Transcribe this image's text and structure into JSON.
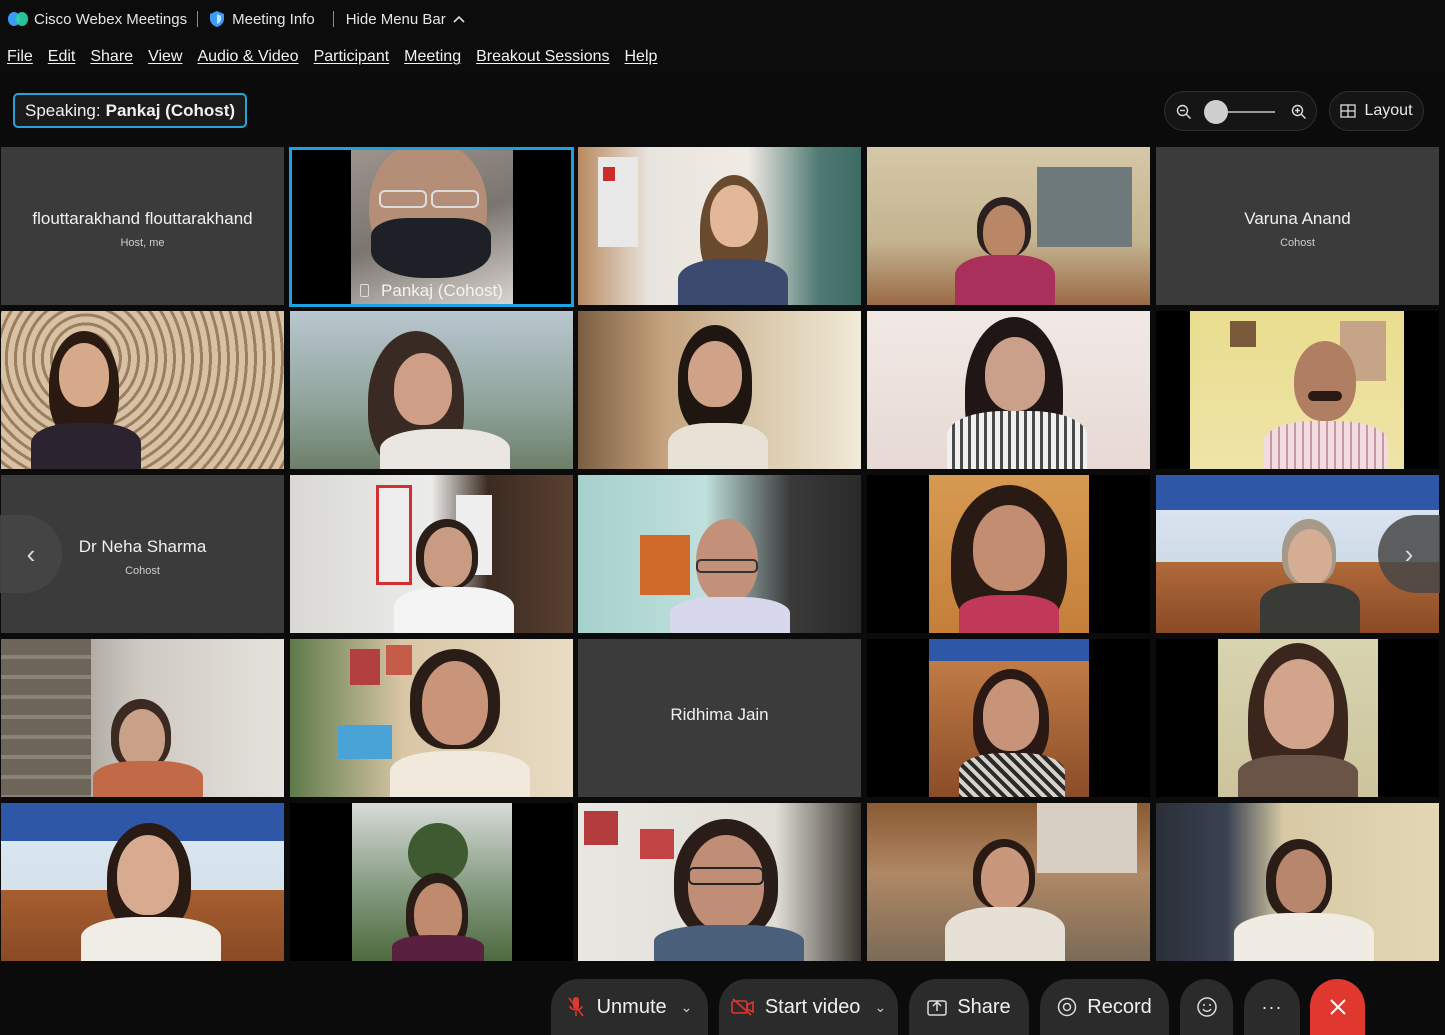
{
  "titlebar": {
    "app_name": "Cisco Webex Meetings",
    "meeting_info": "Meeting Info",
    "hide_menu": "Hide Menu Bar"
  },
  "menu": [
    "File",
    "Edit",
    "Share",
    "View",
    "Audio & Video",
    "Participant",
    "Meeting",
    "Breakout Sessions",
    "Help"
  ],
  "speaking": {
    "label": "Speaking:",
    "name": "Pankaj (Cohost)"
  },
  "layout_button": "Layout",
  "participants": {
    "host": {
      "name": "flouttarakhand flouttarakhand",
      "role": "Host, me"
    },
    "active": {
      "name": "Pankaj  (Cohost)"
    },
    "varuna": {
      "name": "Varuna Anand",
      "role": "Cohost"
    },
    "neha": {
      "name": "Dr Neha Sharma",
      "role": "Cohost"
    },
    "ridhima": {
      "name": "Ridhima Jain"
    }
  },
  "toolbar": {
    "unmute": "Unmute",
    "start_video": "Start video",
    "share": "Share",
    "record": "Record",
    "more": "···"
  },
  "colors": {
    "accent": "#1aa3e0",
    "leave": "#e0372e",
    "background": "#0b0b0b",
    "tile": "#3a3a3a"
  }
}
